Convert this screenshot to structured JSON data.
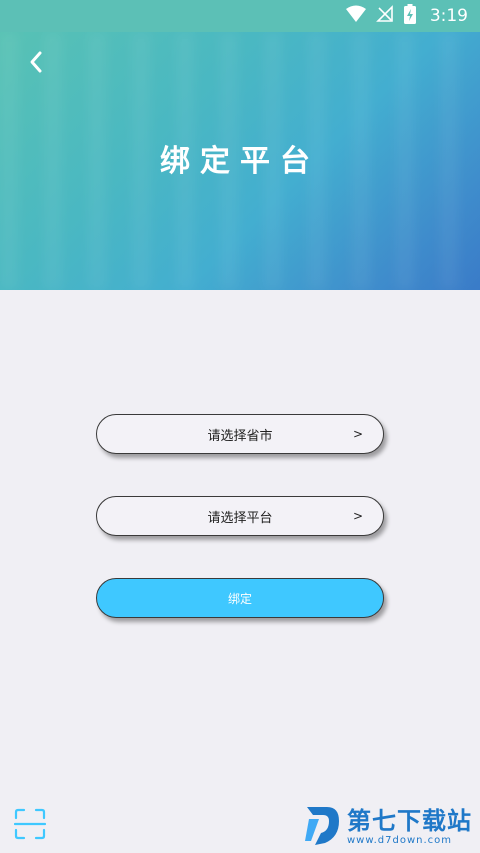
{
  "status_bar": {
    "time": "3:19",
    "icons": [
      "wifi-icon",
      "no-signal-icon",
      "battery-charging-icon"
    ]
  },
  "header": {
    "back_icon": "chevron-left-icon",
    "title": "绑定平台"
  },
  "form": {
    "province_select": {
      "label": "请选择省市",
      "chevron": ">"
    },
    "platform_select": {
      "label": "请选择平台",
      "chevron": ">"
    },
    "bind_button": {
      "label": "绑定"
    }
  },
  "footer": {
    "scan_icon": "scan-icon"
  },
  "watermark": {
    "name": "第七下载站",
    "url": "www.d7down.com"
  },
  "colors": {
    "accent": "#3fc8ff",
    "header_start": "#58c2b4",
    "header_end": "#3a7bc8",
    "background": "#f0eff4",
    "watermark": "#1f78c8"
  }
}
